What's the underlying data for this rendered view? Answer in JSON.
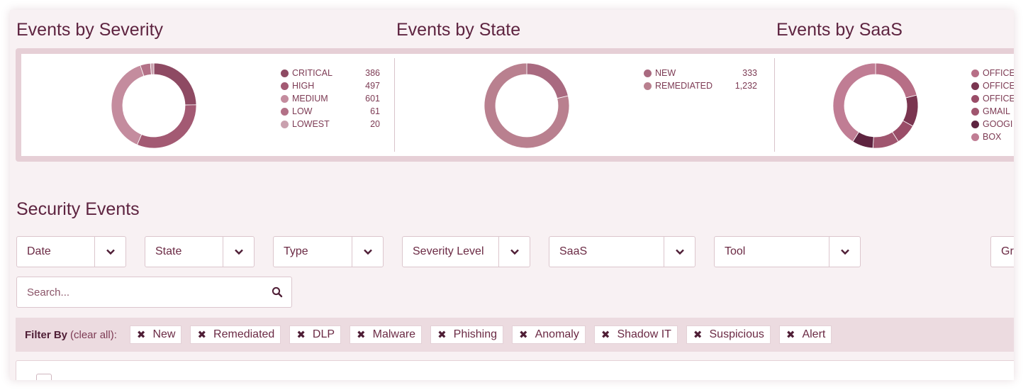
{
  "headings": {
    "severity": "Events by Severity",
    "state": "Events by State",
    "saas": "Events by SaaS",
    "security_events": "Security Events"
  },
  "charts": {
    "severity": {
      "legend": [
        {
          "label": "CRITICAL",
          "value": "386",
          "color": "#8e4a63"
        },
        {
          "label": "HIGH",
          "value": "497",
          "color": "#a35a73"
        },
        {
          "label": "MEDIUM",
          "value": "601",
          "color": "#c48c9e"
        },
        {
          "label": "LOW",
          "value": "61",
          "color": "#b37187"
        },
        {
          "label": "LOWEST",
          "value": "20",
          "color": "#c9a0ae"
        }
      ]
    },
    "state": {
      "legend": [
        {
          "label": "NEW",
          "value": "333",
          "color": "#a96a80"
        },
        {
          "label": "REMEDIATED",
          "value": "1,232",
          "color": "#b9808f"
        }
      ]
    },
    "saas": {
      "legend": [
        {
          "label": "OFFICE",
          "color": "#b76e86"
        },
        {
          "label": "OFFICE",
          "color": "#7a3550"
        },
        {
          "label": "OFFICE",
          "color": "#9a4d68"
        },
        {
          "label": "GMAIL",
          "color": "#a0566f"
        },
        {
          "label": "GOOGI",
          "color": "#5e2440"
        },
        {
          "label": "BOX",
          "color": "#c07d94"
        }
      ]
    }
  },
  "chart_data": [
    {
      "type": "pie",
      "donut": true,
      "title": "Events by Severity",
      "categories": [
        "CRITICAL",
        "HIGH",
        "MEDIUM",
        "LOW",
        "LOWEST"
      ],
      "values": [
        386,
        497,
        601,
        61,
        20
      ]
    },
    {
      "type": "pie",
      "donut": true,
      "title": "Events by State",
      "categories": [
        "NEW",
        "REMEDIATED"
      ],
      "values": [
        333,
        1232
      ]
    },
    {
      "type": "pie",
      "donut": true,
      "title": "Events by SaaS",
      "categories": [
        "OFFICE",
        "OFFICE",
        "OFFICE",
        "GMAIL",
        "GOOGI",
        "BOX"
      ],
      "values": [
        21,
        12,
        8,
        10,
        8,
        41
      ]
    }
  ],
  "filters": {
    "dropdowns": [
      {
        "label": "Date"
      },
      {
        "label": "State"
      },
      {
        "label": "Type"
      },
      {
        "label": "Severity Level"
      },
      {
        "label": "SaaS"
      },
      {
        "label": "Tool"
      },
      {
        "label": "Gr"
      }
    ],
    "search_placeholder": "Search..."
  },
  "filter_bar": {
    "label": "Filter By",
    "clear_all": "(clear all):",
    "chips": [
      "New",
      "Remediated",
      "DLP",
      "Malware",
      "Phishing",
      "Anomaly",
      "Shadow IT",
      "Suspicious",
      "Alert"
    ]
  }
}
